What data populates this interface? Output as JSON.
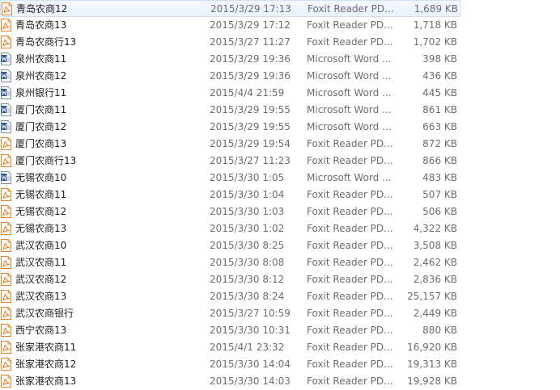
{
  "files": [
    {
      "name": "青岛农商12",
      "date": "2015/3/29 17:13",
      "type": "Foxit Reader PD...",
      "size": "1,689 KB",
      "icon": "pdf-icon"
    },
    {
      "name": "青岛农商13",
      "date": "2015/3/29 17:12",
      "type": "Foxit Reader PD...",
      "size": "1,718 KB",
      "icon": "pdf-icon"
    },
    {
      "name": "青岛农商行13",
      "date": "2015/3/27 11:27",
      "type": "Foxit Reader PD...",
      "size": "1,702 KB",
      "icon": "pdf-icon"
    },
    {
      "name": "泉州农商11",
      "date": "2015/3/29 19:36",
      "type": "Microsoft Word ...",
      "size": "398 KB",
      "icon": "word-icon"
    },
    {
      "name": "泉州农商12",
      "date": "2015/3/29 19:36",
      "type": "Microsoft Word ...",
      "size": "436 KB",
      "icon": "word-icon"
    },
    {
      "name": "泉州银行11",
      "date": "2015/4/4 21:59",
      "type": "Microsoft Word ...",
      "size": "445 KB",
      "icon": "word-icon"
    },
    {
      "name": "厦门农商11",
      "date": "2015/3/29 19:55",
      "type": "Microsoft Word ...",
      "size": "861 KB",
      "icon": "word-icon"
    },
    {
      "name": "厦门农商12",
      "date": "2015/3/29 19:55",
      "type": "Microsoft Word ...",
      "size": "663 KB",
      "icon": "word-icon"
    },
    {
      "name": "厦门农商13",
      "date": "2015/3/29 19:54",
      "type": "Foxit Reader PD...",
      "size": "872 KB",
      "icon": "pdf-icon"
    },
    {
      "name": "厦门农商行13",
      "date": "2015/3/27 11:23",
      "type": "Foxit Reader PD...",
      "size": "866 KB",
      "icon": "pdf-icon"
    },
    {
      "name": "无锡农商10",
      "date": "2015/3/30 1:05",
      "type": "Microsoft Word ...",
      "size": "483 KB",
      "icon": "word-icon"
    },
    {
      "name": "无锡农商11",
      "date": "2015/3/30 1:04",
      "type": "Foxit Reader PD...",
      "size": "507 KB",
      "icon": "pdf-icon"
    },
    {
      "name": "无锡农商12",
      "date": "2015/3/30 1:03",
      "type": "Foxit Reader PD...",
      "size": "506 KB",
      "icon": "pdf-icon"
    },
    {
      "name": "无锡农商13",
      "date": "2015/3/30 1:02",
      "type": "Foxit Reader PD...",
      "size": "4,322 KB",
      "icon": "pdf-icon"
    },
    {
      "name": "武汉农商10",
      "date": "2015/3/30 8:25",
      "type": "Foxit Reader PD...",
      "size": "3,508 KB",
      "icon": "pdf-icon"
    },
    {
      "name": "武汉农商11",
      "date": "2015/3/30 8:08",
      "type": "Foxit Reader PD...",
      "size": "2,462 KB",
      "icon": "pdf-icon"
    },
    {
      "name": "武汉农商12",
      "date": "2015/3/30 8:12",
      "type": "Foxit Reader PD...",
      "size": "2,836 KB",
      "icon": "pdf-icon"
    },
    {
      "name": "武汉农商13",
      "date": "2015/3/30 8:24",
      "type": "Foxit Reader PD...",
      "size": "25,157 KB",
      "icon": "pdf-icon"
    },
    {
      "name": "武汉农商银行",
      "date": "2015/3/27 10:59",
      "type": "Foxit Reader PD...",
      "size": "2,449 KB",
      "icon": "pdf-icon"
    },
    {
      "name": "西宁农商13",
      "date": "2015/3/30 10:31",
      "type": "Foxit Reader PD...",
      "size": "880 KB",
      "icon": "pdf-icon"
    },
    {
      "name": "张家港农商11",
      "date": "2015/4/1 23:32",
      "type": "Foxit Reader PD...",
      "size": "16,920 KB",
      "icon": "pdf-icon"
    },
    {
      "name": "张家港农商12",
      "date": "2015/3/30 14:04",
      "type": "Foxit Reader PD...",
      "size": "19,313 KB",
      "icon": "pdf-icon"
    },
    {
      "name": "张家港农商13",
      "date": "2015/3/30 14:03",
      "type": "Foxit Reader PD...",
      "size": "19,928 KB",
      "icon": "pdf-icon"
    }
  ],
  "colors": {
    "pdf": "#e8822a",
    "word": "#2b5797",
    "hover_bg": "#eaf2fb",
    "hover_border": "#cfe1f5"
  }
}
